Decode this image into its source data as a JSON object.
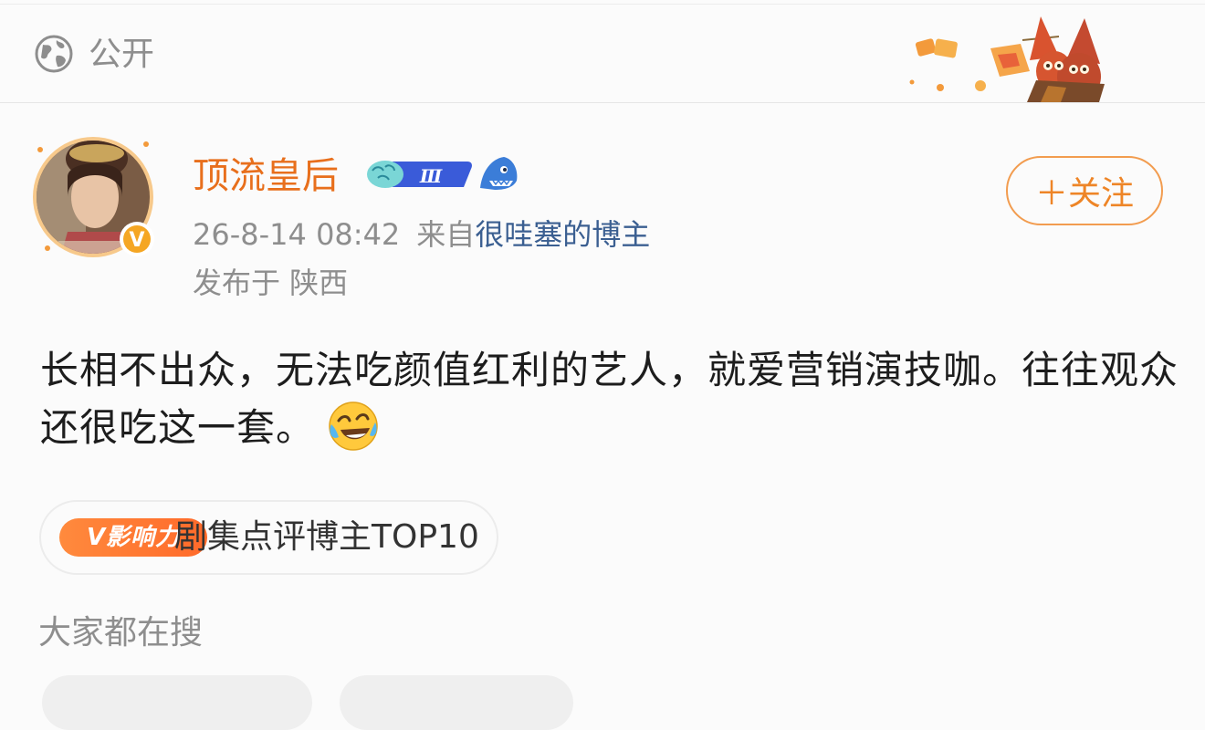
{
  "visibility": {
    "icon": "globe-icon",
    "label": "公开"
  },
  "post": {
    "author": {
      "name": "顶流皇后",
      "verified_badge": "V",
      "level_badge": "Ⅲ"
    },
    "meta": {
      "time": "26-8-14 08:42",
      "source_prefix": "来自",
      "source_link": "很哇塞的博主",
      "location": "发布于 陕西"
    },
    "follow_label": "＋关注",
    "text": "长相不出众，无法吃颜值红利的艺人，就爱营销演技咖。往往观众还很吃这一套。",
    "emoji": "laughing-crying-emoji",
    "influence": {
      "badge_label": "V影响力",
      "label": "剧集点评博主TOP10"
    }
  },
  "search": {
    "title": "大家都在搜"
  },
  "colors": {
    "accent": "#ee8527",
    "username": "#e86f1c",
    "link": "#3b5f91",
    "muted": "#8e8e8e"
  }
}
